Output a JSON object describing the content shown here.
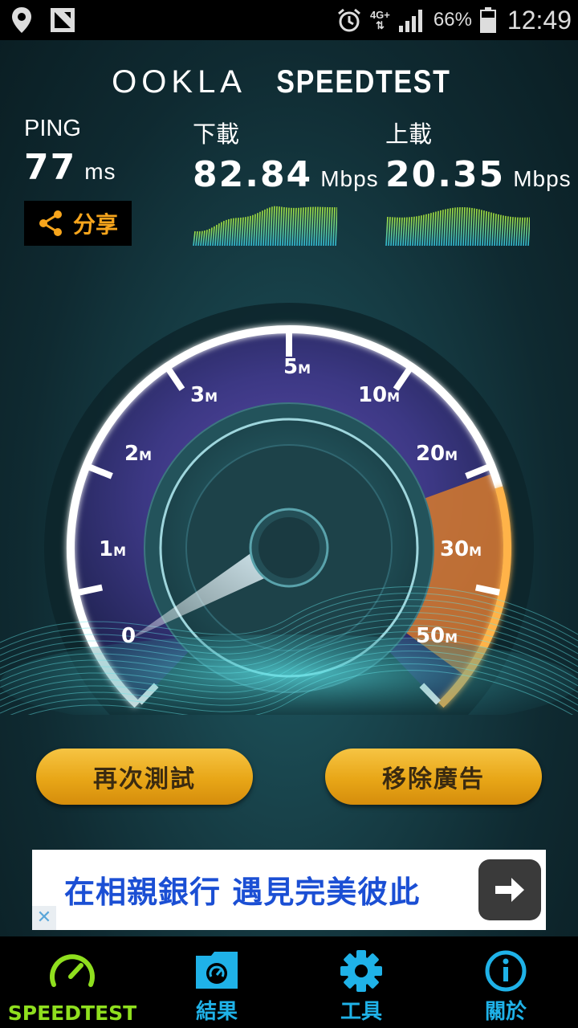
{
  "status_bar": {
    "network": "4G+",
    "battery": "66%",
    "time": "12:49"
  },
  "brand": {
    "ookla": "OOKLA",
    "speedtest": "SPEEDTEST"
  },
  "stats": {
    "ping": {
      "label": "PING",
      "value": "77",
      "unit": "ms"
    },
    "download": {
      "label": "下載",
      "value": "82.84",
      "unit": "Mbps"
    },
    "upload": {
      "label": "上載",
      "value": "20.35",
      "unit": "Mbps"
    }
  },
  "share": {
    "label": "分享"
  },
  "gauge": {
    "ticks": [
      {
        "num": "0",
        "suffix": ""
      },
      {
        "num": "1",
        "suffix": "M"
      },
      {
        "num": "2",
        "suffix": "M"
      },
      {
        "num": "3",
        "suffix": "M"
      },
      {
        "num": "5",
        "suffix": "M"
      },
      {
        "num": "10",
        "suffix": "M"
      },
      {
        "num": "20",
        "suffix": "M"
      },
      {
        "num": "30",
        "suffix": "M"
      },
      {
        "num": "50",
        "suffix": "M"
      }
    ],
    "needle_fraction": 0.03
  },
  "buttons": {
    "retest": "再次測試",
    "remove_ads": "移除廣告"
  },
  "ad": {
    "text": "在相親銀行 遇見完美彼此",
    "close": "✕"
  },
  "nav": {
    "speedtest": "SPEEDTEST",
    "results": "結果",
    "tools": "工具",
    "about": "關於"
  },
  "colors": {
    "accent_orange": "#f7a51c",
    "nav_active": "#8fdf1e",
    "nav_inactive": "#1fb2e8",
    "ad_text": "#1b4fd4"
  }
}
